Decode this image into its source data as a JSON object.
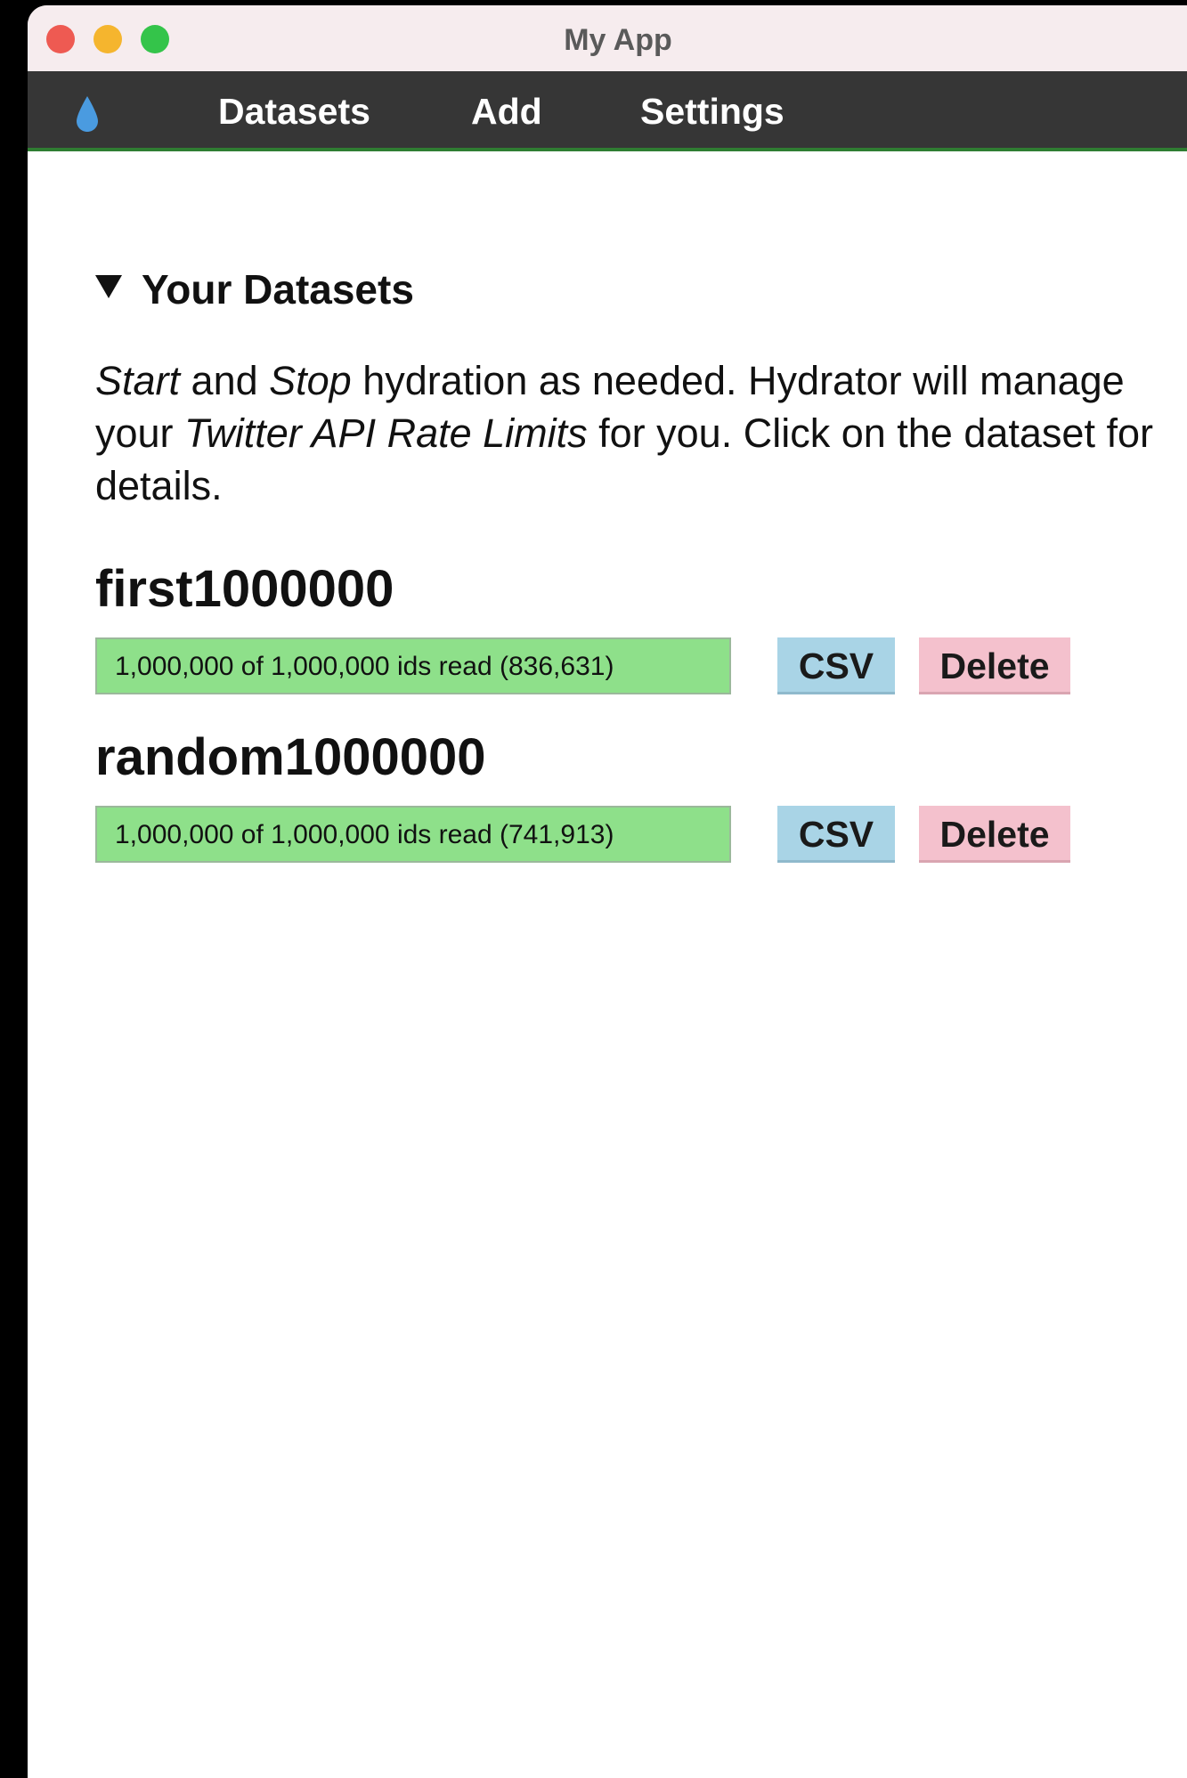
{
  "window": {
    "title": "My App"
  },
  "colors": {
    "close": "#ee5a52",
    "minimize": "#f5b52e",
    "maximize": "#34c44a",
    "logo": "#4a9be0",
    "navbar": "#363636",
    "accent_line": "#2f7d32",
    "progress_fill": "#8ee08a",
    "csv_button": "#a9d4e6",
    "delete_button": "#f4c1cd"
  },
  "navbar": {
    "logo_icon": "water-drop-icon",
    "items": [
      "Datasets",
      "Add",
      "Settings"
    ]
  },
  "section": {
    "title": "Your Datasets",
    "intro": {
      "part1": "Start",
      "part2": " and ",
      "part3": "Stop",
      "part4": " hydration as needed. Hydrator will manage your ",
      "part5": "Twitter API Rate Limits",
      "part6": " for you. Click on the dataset for details."
    }
  },
  "datasets": [
    {
      "name": "first1000000",
      "progress_text": "1,000,000 of 1,000,000 ids read (836,631)",
      "progress_fraction": 1.0,
      "csv_label": "CSV",
      "delete_label": "Delete"
    },
    {
      "name": "random1000000",
      "progress_text": "1,000,000 of 1,000,000 ids read (741,913)",
      "progress_fraction": 1.0,
      "csv_label": "CSV",
      "delete_label": "Delete"
    }
  ]
}
